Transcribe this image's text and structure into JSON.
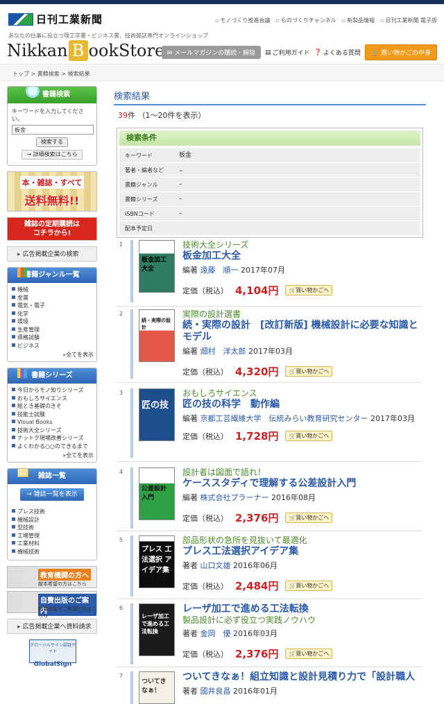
{
  "header": {
    "logo_text": "日刊工業新聞",
    "top_links": [
      "モノづくり推進会議",
      "ものづくりチャンネル",
      "新製品情報",
      "日刊工業新聞 電子版"
    ],
    "tagline": "あなたの仕事に役立つ理工学書・ビジネス書、技術雑誌専門オンラインショップ",
    "brand_a": "Nikkan",
    "brand_b": "B",
    "brand_c": "ookStore",
    "mail_label": "メールマガジンの購読・解除",
    "guide_label": "ご利用ガイド",
    "faq_label": "よくある質問",
    "cart_label": "買い物かごの中身"
  },
  "breadcrumb": {
    "home": "トップ",
    "search": "書籍検索",
    "current": "検索結果"
  },
  "sidebar": {
    "search_title": "書籍検索",
    "search_prompt": "キーワードを入力してください。",
    "search_value": "板金",
    "search_button": "検索する",
    "advanced_button": "詳細検索はこちら",
    "free_l1": "本・雑誌・すべて",
    "free_l2": "送料無料!!",
    "mag_l1": "雑誌の定期購読は",
    "mag_l2": "コチラから!",
    "ad_search": "広告掲載企業の検索",
    "genre_title": "書籍ジャンル一覧",
    "genres": [
      "機械",
      "金属",
      "電気・電子",
      "化学",
      "環境",
      "生産管理",
      "資格試験",
      "ビジネス"
    ],
    "genre_more": "全てを表示",
    "series_title": "書籍シリーズ",
    "series": [
      "今日からモノ知りシリーズ",
      "おもしろサイエンス",
      "絵とき基礎のきそ",
      "技能士試験",
      "Visual Books",
      "技術大全シリーズ",
      "ナットク現場改善シリーズ",
      "よくわかる○○のできるまで"
    ],
    "series_more": "全てを表示",
    "mag_title": "雑誌一覧",
    "mag_button": "雑誌一覧を表示",
    "mags": [
      "プレス技術",
      "機械設計",
      "型技術",
      "工場管理",
      "工業材料",
      "機械技術"
    ],
    "edu_title": "教育機関の方へ",
    "edu_sub": "献本希望の方はこちら",
    "self_title": "自費出版のご案内",
    "self_sub": "自費出版をご希望の方はこちら",
    "ad_request": "広告掲載企業へ資料請求",
    "gs_text": "グローバルサイン認証サイト",
    "gs_brand": "GlobalSign"
  },
  "main": {
    "heading": "検索結果",
    "count_num": "39",
    "count_unit": "件",
    "count_range": "（1〜20件を表示）",
    "cond_title": "検索条件",
    "cond_rows": [
      {
        "k": "キーワード",
        "v": "板金"
      },
      {
        "k": "著者・編者など",
        "v": "–"
      },
      {
        "k": "書籍ジャンル",
        "v": "–"
      },
      {
        "k": "書籍シリーズ",
        "v": "–"
      },
      {
        "k": "ISBNコード",
        "v": "–"
      },
      {
        "k": "配本予定日",
        "v": ""
      }
    ],
    "price_label": "定価（税込）",
    "cart_button": "買い物かごへ",
    "results": [
      {
        "num": "1",
        "series": "技術大全シリーズ",
        "title": "板金加工大全",
        "role": "編著",
        "name": "遠藤　順一",
        "date": "2017年07月",
        "price": "4,104円",
        "cover_text": "板金加工大全"
      },
      {
        "num": "2",
        "series": "実際の設計選書",
        "title": "続・実際の設計　[改訂新版] 機械設計に必要な知識とモデル",
        "role": "編著",
        "name": "畑村　洋太郎",
        "date": "2017年03月",
        "price": "4,320円",
        "cover_text": "続・実際の設計"
      },
      {
        "num": "3",
        "series": "おもしろサイエンス",
        "title": "匠の技の科学　動作編",
        "role": "編著",
        "name": "京都工芸繊維大学　伝統みらい教育研究センター",
        "date": "2017年03月",
        "price": "1,728円",
        "cover_text": "匠の技"
      },
      {
        "num": "4",
        "series": "設計者は図面で語れ！",
        "title": "ケーススタディで理解する公差設計入門",
        "role": "編著",
        "name": "株式会社プラーナー",
        "date": "2016年08月",
        "price": "2,376円",
        "cover_text": "公差設計入門"
      },
      {
        "num": "5",
        "series": "部品形状の急所を見抜いて最適化",
        "title": "プレス工法選択アイデア集",
        "role": "著者",
        "name": "山口文雄",
        "date": "2016年06月",
        "price": "2,484円",
        "cover_text": "プレス 工法選択 アイデア集"
      },
      {
        "num": "6",
        "series": "",
        "title": "レーザ加工で進める工法転換",
        "subtitle": "製品設計に必ず役立つ実践ノウハウ",
        "role": "著者",
        "name": "金岡　優",
        "date": "2016年03月",
        "price": "2,376円",
        "cover_text": "レーザ加工で進める工法転換"
      },
      {
        "num": "7",
        "series": "",
        "title": "ついてきなぁ！組立知識と設計見積り力で「設計職人",
        "role": "著者",
        "name": "國井良昌",
        "date": "2016年01月",
        "price": "",
        "cover_text": "ついてきなぁ！"
      }
    ]
  }
}
